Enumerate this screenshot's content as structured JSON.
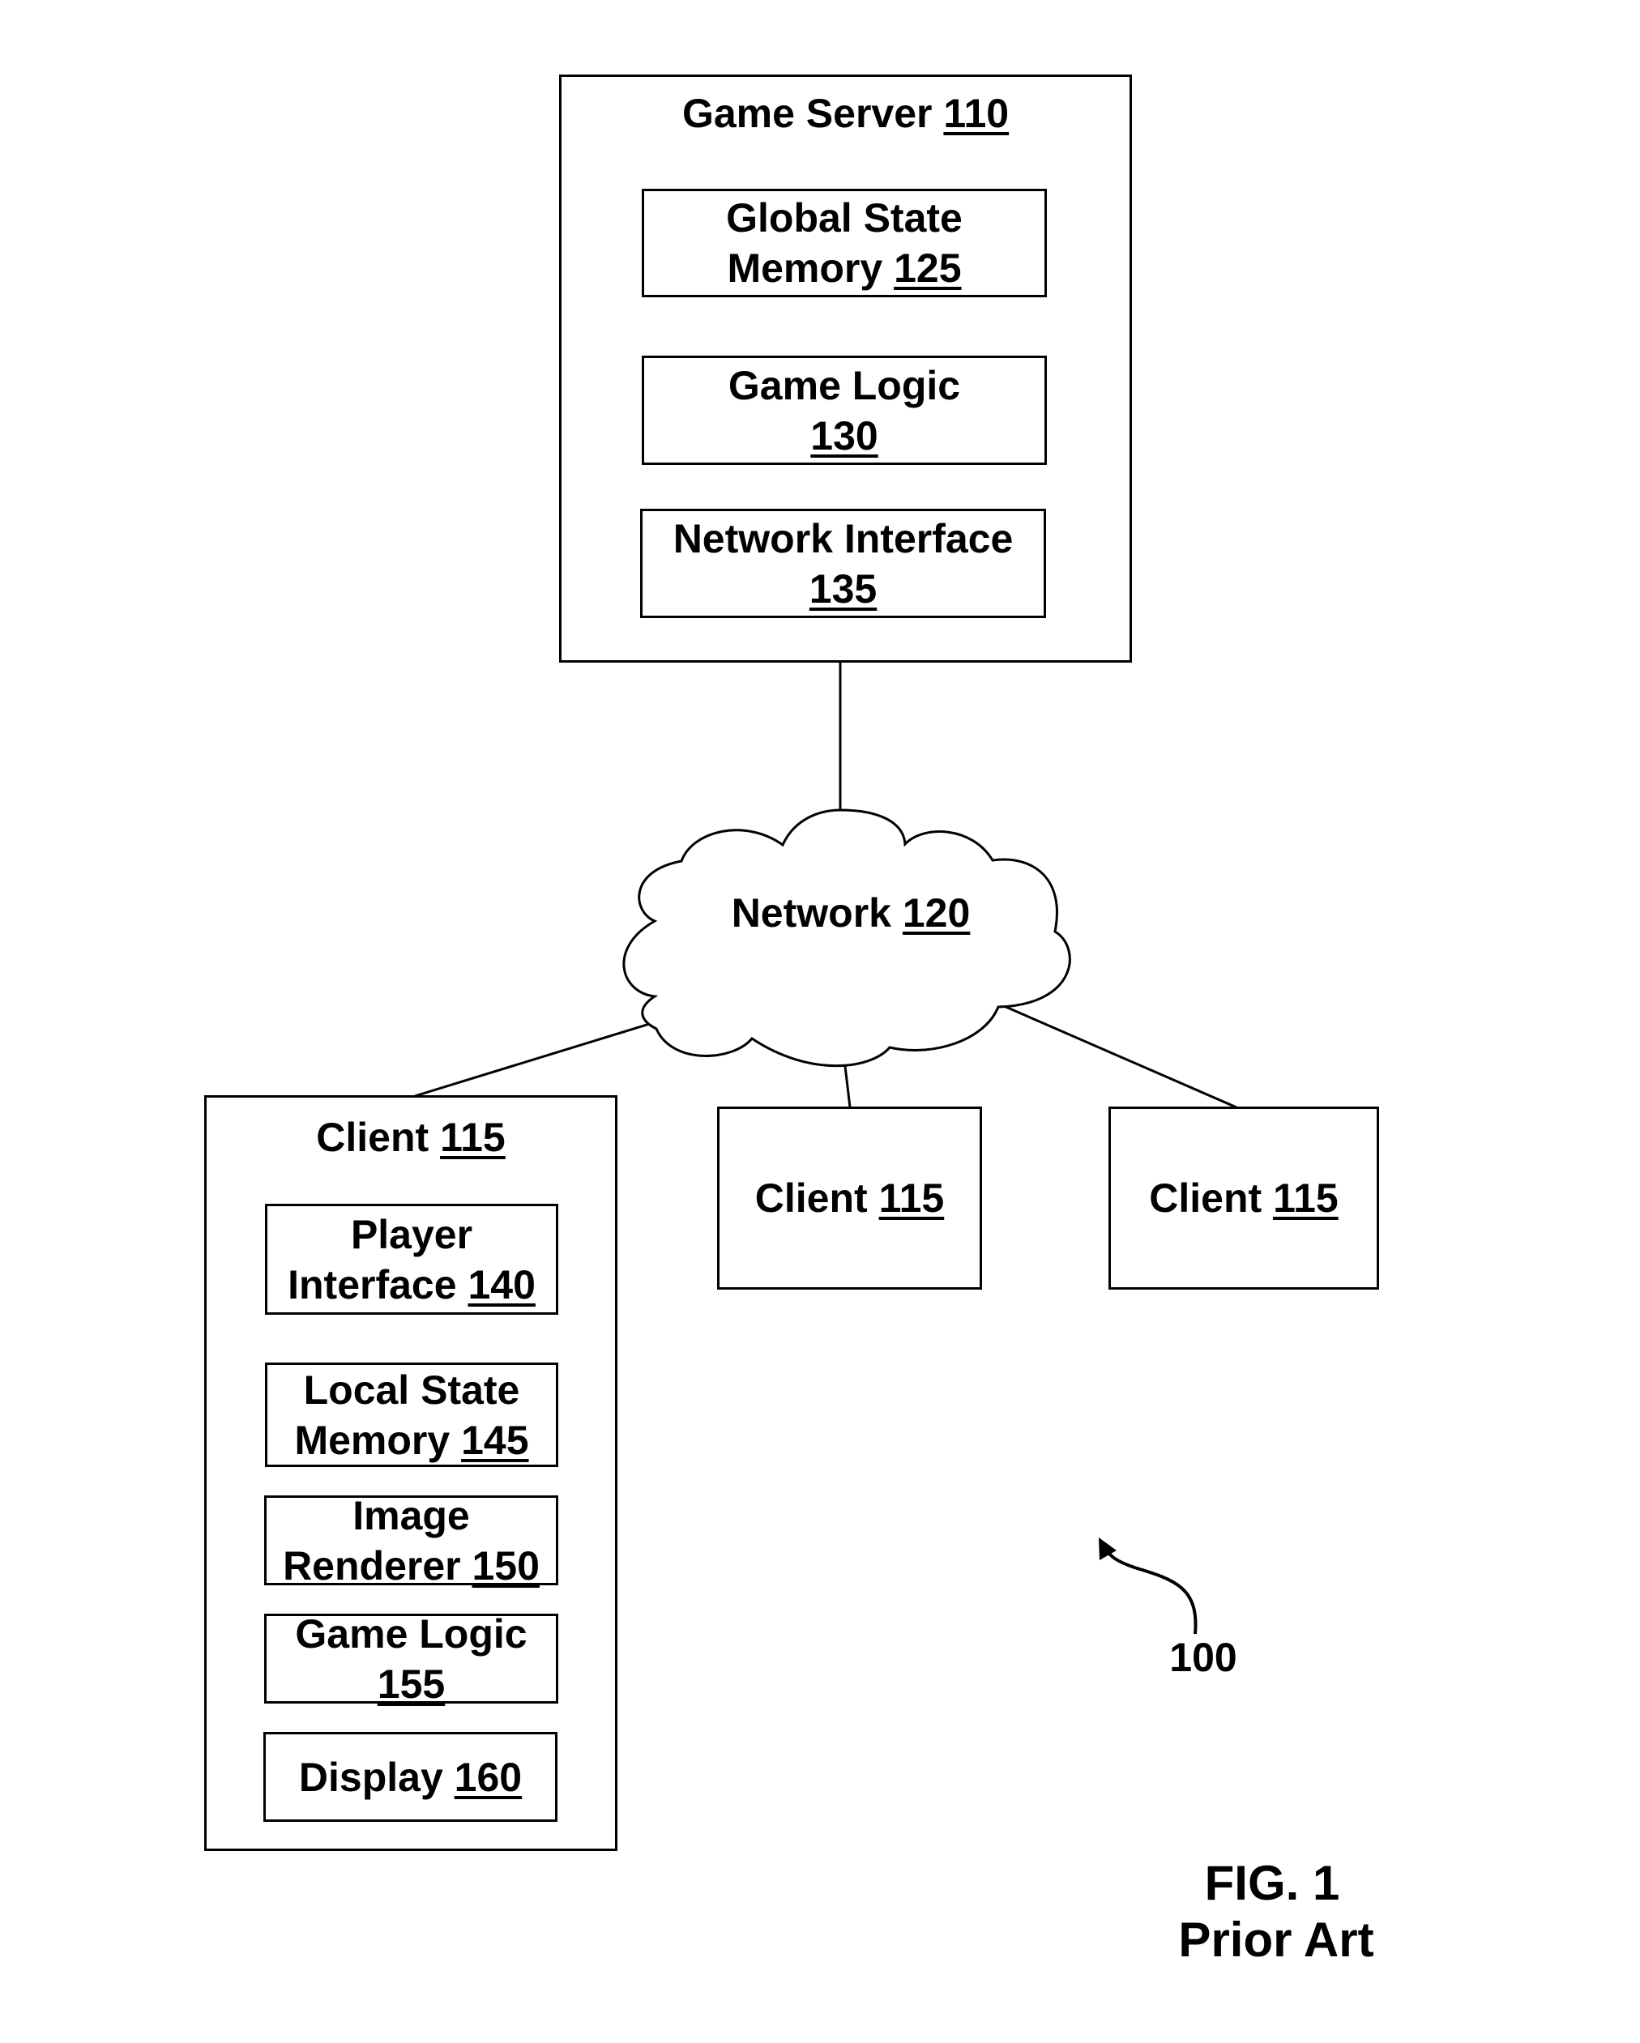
{
  "figure": {
    "caption": "FIG. 1",
    "subcaption": "Prior Art",
    "reference_numeral": "100"
  },
  "game_server": {
    "title": "Game Server",
    "num": "110",
    "components": [
      {
        "line1": "Global State",
        "line2": "Memory",
        "num": "125"
      },
      {
        "line1": "Game Logic",
        "line2": "",
        "num": "130"
      },
      {
        "line1": "Network Interface",
        "line2": "",
        "num": "135"
      }
    ]
  },
  "network": {
    "title": "Network",
    "num": "120"
  },
  "client_main": {
    "title": "Client",
    "num": "115",
    "components": [
      {
        "line1": "Player",
        "line2": "Interface",
        "num": "140"
      },
      {
        "line1": "Local State",
        "line2": "Memory",
        "num": "145"
      },
      {
        "line1": "Image",
        "line2": "Renderer",
        "num": "150"
      },
      {
        "line1": "Game Logic",
        "line2": "",
        "num": "155"
      },
      {
        "line1": "",
        "line2": "Display",
        "num": "160"
      }
    ]
  },
  "clients_other": [
    {
      "title": "Client",
      "num": "115"
    },
    {
      "title": "Client",
      "num": "115"
    }
  ]
}
